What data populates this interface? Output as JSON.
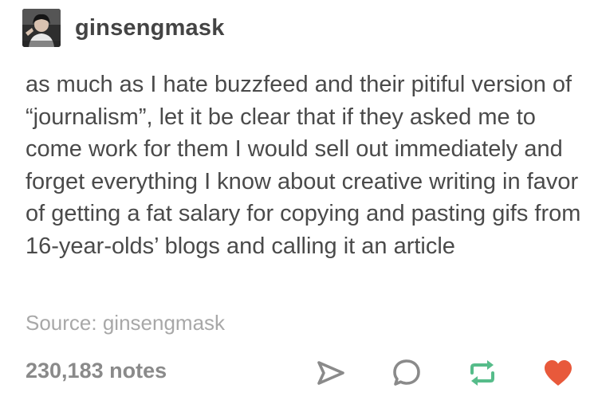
{
  "post": {
    "username": "ginsengmask",
    "body": "as much as I hate buzzfeed and their pitiful version of “journalism”, let it be clear that if they asked me to come work for them I would sell out immediately and forget everything I know about creative writing in favor of getting a fat salary for copying and pasting gifs from 16-year-olds’ blogs and calling it an article",
    "source_label": "Source:",
    "source_name": "ginsengmask"
  },
  "footer": {
    "notes": "230,183 notes",
    "actions": [
      {
        "icon": "share-icon",
        "color": "#8a8a8a"
      },
      {
        "icon": "reply-icon",
        "color": "#8a8a8a"
      },
      {
        "icon": "reblog-icon",
        "color": "#56bc8a"
      },
      {
        "icon": "like-icon",
        "color": "#e8593b"
      }
    ]
  }
}
